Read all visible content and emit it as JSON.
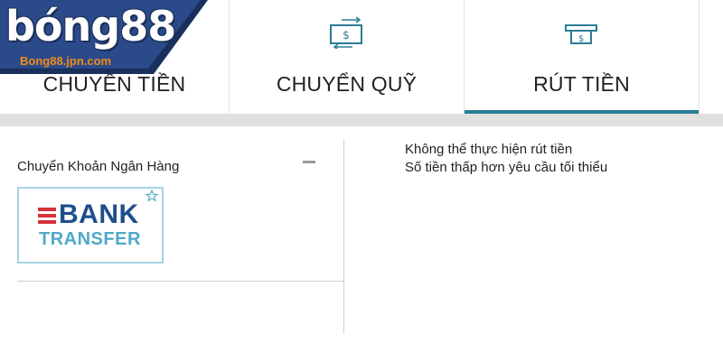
{
  "logo": {
    "text": "bóng88",
    "subtext": "Bong88.jpn.com"
  },
  "tabs": [
    {
      "label": "CHUYỂN TIỀN",
      "icon": "none",
      "active": false
    },
    {
      "label": "CHUYỂN QUỸ",
      "icon": "transfer-icon",
      "active": false
    },
    {
      "label": "RÚT TIỀN",
      "icon": "withdraw-icon",
      "active": true
    }
  ],
  "payment": {
    "title": "Chuyển Khoản Ngân Hàng",
    "card": {
      "line1": "BANK",
      "line2": "TRANSFER"
    }
  },
  "message": {
    "line1": "Không thể thực hiện rút tiền",
    "line2": "Số tiền thấp hơn yêu cầu tối thiểu"
  },
  "colors": {
    "accent": "#2a7d95",
    "bank_blue": "#1f4e8c",
    "bank_light_blue": "#4fa9c7",
    "bank_red": "#d6323a",
    "logo_orange": "#f28a1a",
    "logo_navy": "#1a2f5c"
  }
}
